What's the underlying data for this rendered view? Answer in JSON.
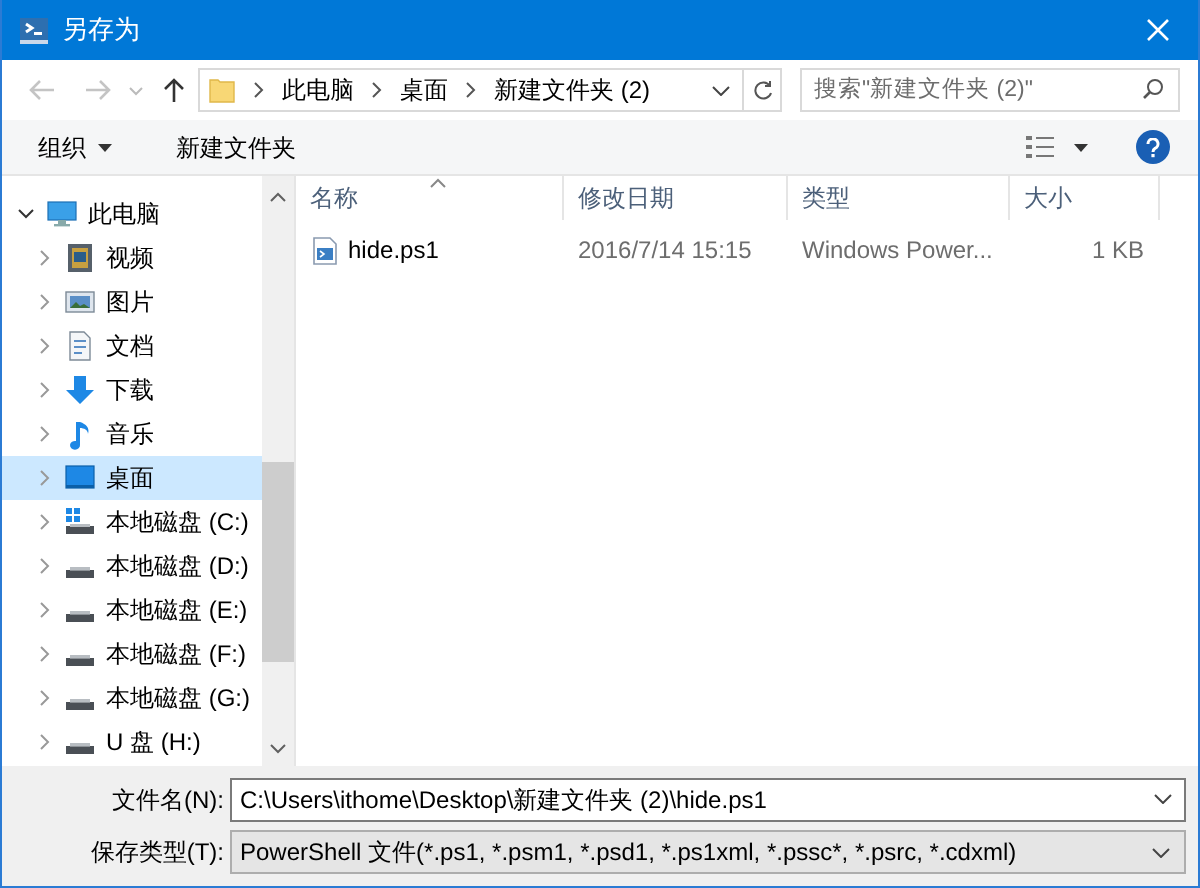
{
  "window": {
    "title": "另存为"
  },
  "nav": {
    "back": {
      "disabled": true
    },
    "forward": {
      "disabled": true
    },
    "up": {
      "disabled": false
    }
  },
  "address": {
    "breadcrumbs": [
      "此电脑",
      "桌面",
      "新建文件夹 (2)"
    ]
  },
  "search": {
    "placeholder": "搜索\"新建文件夹 (2)\""
  },
  "toolbar": {
    "organize": "组织",
    "new_folder": "新建文件夹"
  },
  "tree": [
    {
      "label": "此电脑",
      "kind": "computer",
      "expanded": true,
      "selected": false,
      "children": [
        {
          "label": "视频",
          "kind": "videos",
          "expanded": false,
          "selected": false
        },
        {
          "label": "图片",
          "kind": "pictures",
          "expanded": false,
          "selected": false
        },
        {
          "label": "文档",
          "kind": "documents",
          "expanded": false,
          "selected": false
        },
        {
          "label": "下载",
          "kind": "downloads",
          "expanded": false,
          "selected": false
        },
        {
          "label": "音乐",
          "kind": "music",
          "expanded": false,
          "selected": false
        },
        {
          "label": "桌面",
          "kind": "desktop",
          "expanded": false,
          "selected": true
        },
        {
          "label": "本地磁盘 (C:)",
          "kind": "system-drive",
          "expanded": false,
          "selected": false
        },
        {
          "label": "本地磁盘 (D:)",
          "kind": "drive",
          "expanded": false,
          "selected": false
        },
        {
          "label": "本地磁盘 (E:)",
          "kind": "drive",
          "expanded": false,
          "selected": false
        },
        {
          "label": "本地磁盘 (F:)",
          "kind": "drive",
          "expanded": false,
          "selected": false
        },
        {
          "label": "本地磁盘 (G:)",
          "kind": "drive",
          "expanded": false,
          "selected": false
        },
        {
          "label": "U 盘 (H:)",
          "kind": "drive",
          "expanded": false,
          "selected": false
        }
      ]
    }
  ],
  "columns": [
    {
      "label": "名称",
      "sorted": true
    },
    {
      "label": "修改日期",
      "sorted": false
    },
    {
      "label": "类型",
      "sorted": false
    },
    {
      "label": "大小",
      "sorted": false
    }
  ],
  "files": [
    {
      "name": "hide.ps1",
      "modified": "2016/7/14 15:15",
      "type": "Windows Power...",
      "size": "1 KB",
      "selected": false
    }
  ],
  "filename": {
    "label": "文件名(N):",
    "value": "C:\\Users\\ithome\\Desktop\\新建文件夹 (2)\\hide.ps1"
  },
  "save_type": {
    "label": "保存类型(T):",
    "value": "PowerShell 文件(*.ps1, *.psm1, *.psd1, *.ps1xml, *.pssc*, *.psrc, *.cdxml)"
  }
}
